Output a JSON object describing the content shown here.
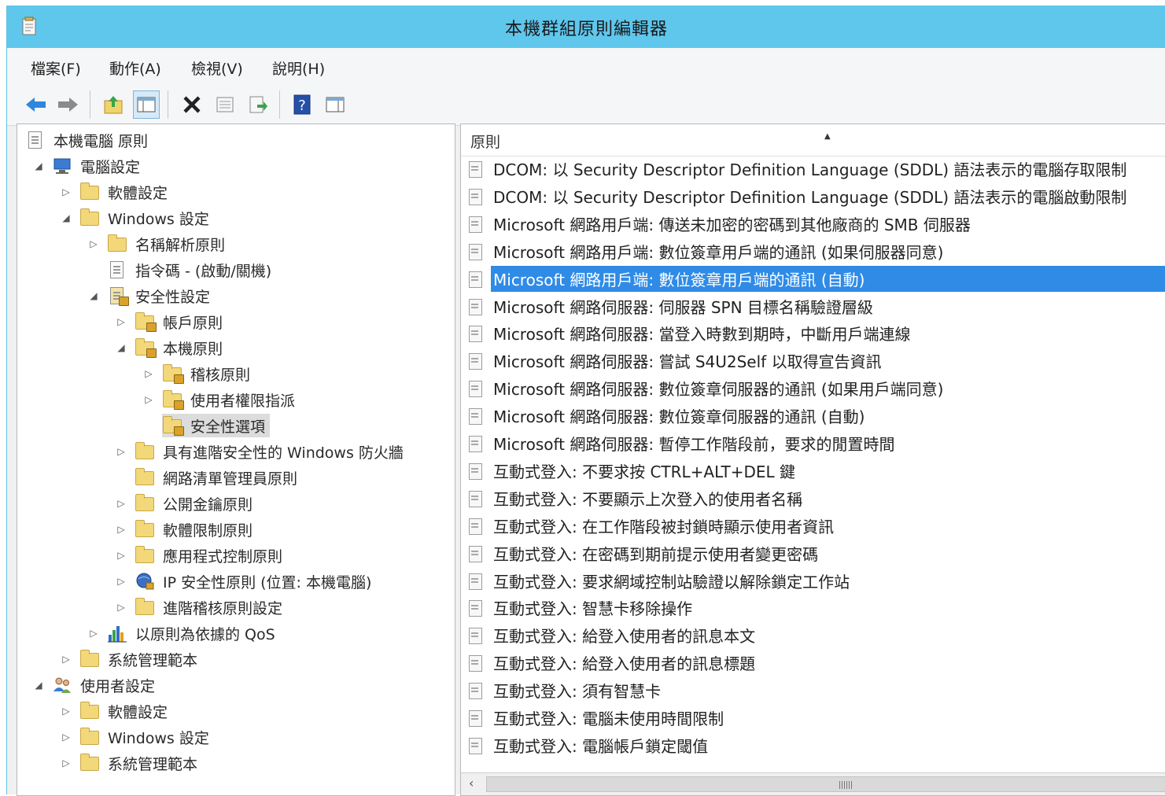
{
  "window": {
    "title": "本機群組原則編輯器"
  },
  "menu": [
    "檔案(F)",
    "動作(A)",
    "檢視(V)",
    "說明(H)"
  ],
  "toolbar": {
    "buttons": [
      "back-icon",
      "forward-icon",
      "up-folder-icon",
      "show-hide-console-tree-icon",
      "delete-icon",
      "properties-icon",
      "export-list-icon",
      "help-icon",
      "show-action-pane-icon"
    ]
  },
  "tree": [
    {
      "label": "本機電腦 原則",
      "toggle": ""
    },
    {
      "label": "電腦設定",
      "toggle": "◢"
    },
    {
      "label": "軟體設定",
      "toggle": "▷"
    },
    {
      "label": "Windows 設定",
      "toggle": "◢"
    },
    {
      "label": "名稱解析原則",
      "toggle": "▷"
    },
    {
      "label": "指令碼 - (啟動/關機)",
      "toggle": ""
    },
    {
      "label": "安全性設定",
      "toggle": "◢"
    },
    {
      "label": "帳戶原則",
      "toggle": "▷"
    },
    {
      "label": "本機原則",
      "toggle": "◢"
    },
    {
      "label": "稽核原則",
      "toggle": "▷"
    },
    {
      "label": "使用者權限指派",
      "toggle": "▷"
    },
    {
      "label": "安全性選項",
      "toggle": ""
    },
    {
      "label": "具有進階安全性的 Windows 防火牆",
      "toggle": "▷"
    },
    {
      "label": "網路清單管理員原則",
      "toggle": ""
    },
    {
      "label": "公開金鑰原則",
      "toggle": "▷"
    },
    {
      "label": "軟體限制原則",
      "toggle": "▷"
    },
    {
      "label": "應用程式控制原則",
      "toggle": "▷"
    },
    {
      "label": "IP 安全性原則 (位置: 本機電腦)",
      "toggle": "▷"
    },
    {
      "label": "進階稽核原則設定",
      "toggle": "▷"
    },
    {
      "label": "以原則為依據的 QoS",
      "toggle": "▷"
    },
    {
      "label": "系統管理範本",
      "toggle": "▷"
    },
    {
      "label": "使用者設定",
      "toggle": "◢"
    },
    {
      "label": "軟體設定",
      "toggle": "▷"
    },
    {
      "label": "Windows 設定",
      "toggle": "▷"
    },
    {
      "label": "系統管理範本",
      "toggle": "▷"
    }
  ],
  "policy_list": {
    "column_header": "原則",
    "selected_index": 4,
    "items": [
      "DCOM: 以 Security Descriptor Definition Language (SDDL) 語法表示的電腦存取限制",
      "DCOM: 以 Security Descriptor Definition Language (SDDL) 語法表示的電腦啟動限制",
      "Microsoft 網路用戶端: 傳送未加密的密碼到其他廠商的 SMB 伺服器",
      "Microsoft 網路用戶端: 數位簽章用戶端的通訊 (如果伺服器同意)",
      "Microsoft 網路用戶端: 數位簽章用戶端的通訊 (自動)",
      "Microsoft 網路伺服器: 伺服器 SPN 目標名稱驗證層級",
      "Microsoft 網路伺服器: 當登入時數到期時，中斷用戶端連線",
      "Microsoft 網路伺服器: 嘗試 S4U2Self 以取得宣告資訊",
      "Microsoft 網路伺服器: 數位簽章伺服器的通訊 (如果用戶端同意)",
      "Microsoft 網路伺服器: 數位簽章伺服器的通訊 (自動)",
      "Microsoft 網路伺服器: 暫停工作階段前，要求的閒置時間",
      "互動式登入: 不要求按 CTRL+ALT+DEL 鍵",
      "互動式登入: 不要顯示上次登入的使用者名稱",
      "互動式登入: 在工作階段被封鎖時顯示使用者資訊",
      "互動式登入: 在密碼到期前提示使用者變更密碼",
      "互動式登入: 要求網域控制站驗證以解除鎖定工作站",
      "互動式登入: 智慧卡移除操作",
      "互動式登入: 給登入使用者的訊息本文",
      "互動式登入: 給登入使用者的訊息標題",
      "互動式登入: 須有智慧卡",
      "互動式登入: 電腦未使用時間限制",
      "互動式登入: 電腦帳戶鎖定閾值"
    ]
  }
}
